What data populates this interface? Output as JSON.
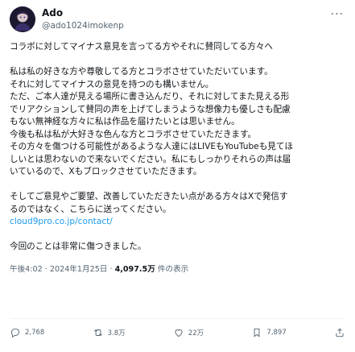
{
  "author": {
    "display_name": "Ado",
    "handle": "@ado1024imokenp"
  },
  "more_label": "···",
  "post": {
    "line_01": "コラボに対してマイナス意見を言ってる方やそれに賛同してる方々へ",
    "line_02": "私は私の好きな方や尊敬してる方とコラボさせていただいています。",
    "line_03": "それに対してマイナスの意見を持つのも構いません。",
    "line_04": "ただ、ご本人達が見える場所に書き込んだり、それに対してまた見える形",
    "line_05": "でリアクションして賛同の声を上げてしまうような想像力も優しさも配慮",
    "line_06": "もない無神経な方々に私は作品を届けたいとは思いません。",
    "line_07": "今後も私は私が大好きな色んな方とコラボさせていただきます。",
    "line_08": "その方々を傷つける可能性があるような人達にはLIVEもYouTubeも見てほ",
    "line_09": "しいとは思わないので来ないでください。私にもしっかりそれらの声は届",
    "line_10": "いているので、Xもブロックさせていただきます。",
    "line_11": "そしてご意見やご要望、改善していただきたい点がある方々はXで発信す",
    "line_12": "るのではなく、こちらに送ってください。",
    "link": "cloud9pro.co.jp/contact/",
    "line_13": "今回のことは非常に傷つきました。"
  },
  "meta": {
    "time": "午後4:02",
    "sep1": " · ",
    "date": "2024年1月25日",
    "sep2": " · ",
    "views": "4,097.5万",
    "views_suffix": " 件の表示"
  },
  "actions": {
    "replies": "2,768",
    "reposts": "3.8万",
    "likes": "22万",
    "bookmarks": "7,897"
  },
  "icons": [
    "reply-icon",
    "repost-icon",
    "like-icon",
    "bookmark-icon",
    "share-icon"
  ]
}
